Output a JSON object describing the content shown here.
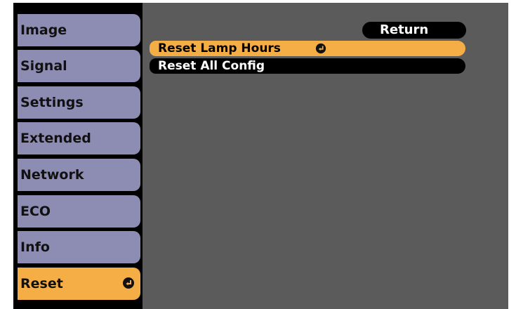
{
  "left_menu": {
    "items": [
      {
        "label": "Image",
        "active": false
      },
      {
        "label": "Signal",
        "active": false
      },
      {
        "label": "Settings",
        "active": false
      },
      {
        "label": "Extended",
        "active": false
      },
      {
        "label": "Network",
        "active": false
      },
      {
        "label": "ECO",
        "active": false
      },
      {
        "label": "Info",
        "active": false
      },
      {
        "label": "Reset",
        "active": true,
        "icon": "enter-icon"
      }
    ]
  },
  "submenu": {
    "return_label": "Return",
    "options": [
      {
        "label": "Reset Lamp Hours",
        "selected": true,
        "icon": "enter-icon"
      },
      {
        "label": "Reset All Config",
        "selected": false
      }
    ]
  },
  "colors": {
    "tab": "#8d8cb3",
    "active": "#f4ae45",
    "panel": "#5b5b5b",
    "frame": "#000000"
  }
}
